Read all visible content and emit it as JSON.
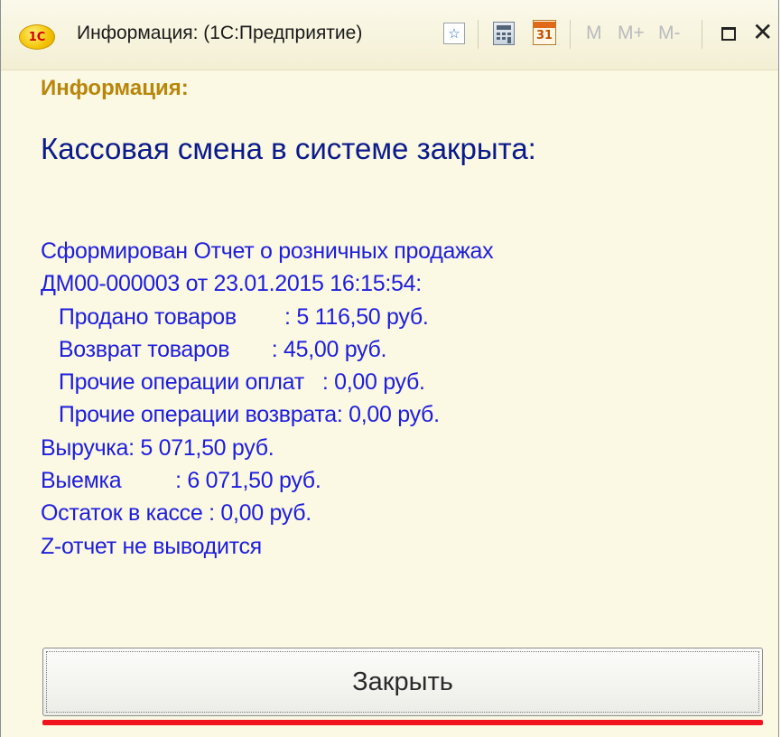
{
  "window": {
    "logo_text": "1С",
    "title": "Информация:  (1С:Предприятие)",
    "toolbar": {
      "calendar_day": "31",
      "m_label": "M",
      "m_plus_label": "M+",
      "m_minus_label": "M-"
    }
  },
  "content": {
    "info_label": "Информация:",
    "heading": "Кассовая смена в системе закрыта:",
    "message_lines": [
      "Сформирован Отчет о розничных продажах",
      "ДМ00-000003 от 23.01.2015 16:15:54:",
      "   Продано товаров        : 5 116,50 руб.",
      "   Возврат товаров       : 45,00 руб.",
      "   Прочие операции оплат   : 0,00 руб.",
      "   Прочие операции возврата: 0,00 руб.",
      "Выручка: 5 071,50 руб.",
      "Выемка         : 6 071,50 руб.",
      "Остаток в кассе : 0,00 руб.",
      "Z-отчет не выводится"
    ]
  },
  "buttons": {
    "close_label": "Закрыть"
  }
}
